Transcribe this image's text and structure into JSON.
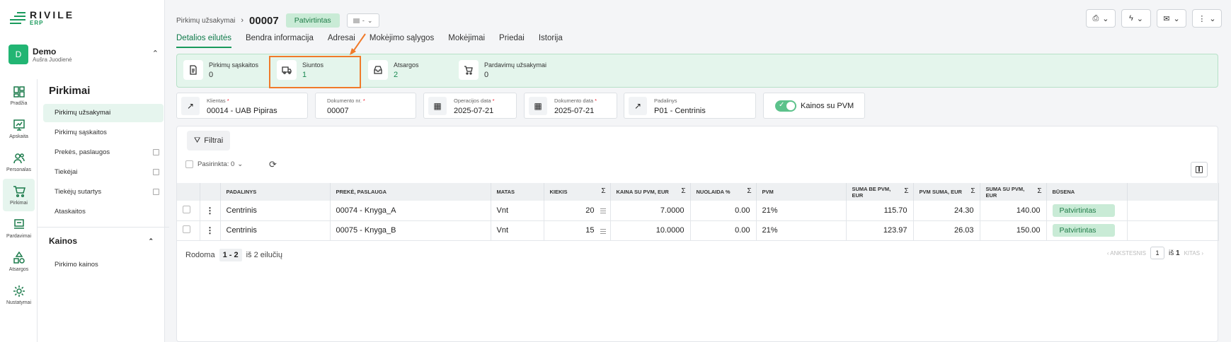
{
  "app": {
    "brand": "RIVILE",
    "brand_sub": "ERP"
  },
  "org": {
    "avatar": "D",
    "name": "Demo",
    "user": "Aušra Juodienė"
  },
  "rail": [
    {
      "label": "Pradžia",
      "icon": "dashboard-icon"
    },
    {
      "label": "Apskaita",
      "icon": "chart-icon"
    },
    {
      "label": "Personalas",
      "icon": "people-icon"
    },
    {
      "label": "Pirkimai",
      "icon": "cart-icon"
    },
    {
      "label": "Pardavimai",
      "icon": "sales-icon"
    },
    {
      "label": "Atsargos",
      "icon": "shapes-icon"
    },
    {
      "label": "Nustatymai",
      "icon": "gear-icon"
    }
  ],
  "nav": {
    "title": "Pirkimai",
    "items": [
      "Pirkimų užsakymai",
      "Pirkimų sąskaitos",
      "Prekės, paslaugos",
      "Tiekėjai",
      "Tiekėjų sutartys",
      "Ataskaitos"
    ],
    "section": "Kainos",
    "section_items": [
      "Pirkimo kainos"
    ]
  },
  "header": {
    "breadcrumb": "Pirkimų užsakymai",
    "doc_number": "00007",
    "status": "Patvirtintas",
    "mini_dropdown": "-"
  },
  "tabs": [
    "Detalios eilutės",
    "Bendra informacija",
    "Adresai",
    "Mokėjimo sąlygos",
    "Mokėjimai",
    "Priedai",
    "Istorija"
  ],
  "summary": [
    {
      "label": "Pirkimų sąskaitos",
      "value": "0"
    },
    {
      "label": "Siuntos",
      "value": "1"
    },
    {
      "label": "Atsargos",
      "value": "2"
    },
    {
      "label": "Pardavimų užsakymai",
      "value": "0"
    }
  ],
  "fields": {
    "client_label": "Klientas",
    "client_value": "00014 - UAB Pipiras",
    "docnr_label": "Dokumento nr.",
    "docnr_value": "00007",
    "opdate_label": "Operacijos data",
    "opdate_value": "2025-07-21",
    "docdate_label": "Dokumento data",
    "docdate_value": "2025-07-21",
    "dept_label": "Padalinys",
    "dept_value": "P01 - Centrinis",
    "prices_vat_label": "Kainos su PVM"
  },
  "table": {
    "filters_label": "Filtrai",
    "selected_label": "Pasirinkta: 0",
    "headers": [
      "Padalinys",
      "Prekė, paslauga",
      "Matas",
      "Kiekis",
      "Kaina su PVM, EUR",
      "Nuolaida %",
      "PVM",
      "Suma be PVM, EUR",
      "PVM suma, EUR",
      "Suma su PVM, EUR",
      "Būsena"
    ],
    "rows": [
      [
        "Centrinis",
        "00074 - Knyga_A",
        "Vnt",
        "20",
        "7.0000",
        "0.00",
        "21%",
        "115.70",
        "24.30",
        "140.00",
        "Patvirtintas"
      ],
      [
        "Centrinis",
        "00075 - Knyga_B",
        "Vnt",
        "15",
        "10.0000",
        "0.00",
        "21%",
        "123.97",
        "26.03",
        "150.00",
        "Patvirtintas"
      ]
    ]
  },
  "pager": {
    "shown": "Rodoma",
    "range": "1 - 2",
    "of_rows": "iš 2 eilučių",
    "prev": "ANKSTESNIS",
    "page": "1",
    "of": "iš",
    "total": "1",
    "next": "KITAS"
  },
  "colors": {
    "accent": "#1a9a5c",
    "highlight": "#f07a2a",
    "status_bg": "#c9ebd6"
  }
}
